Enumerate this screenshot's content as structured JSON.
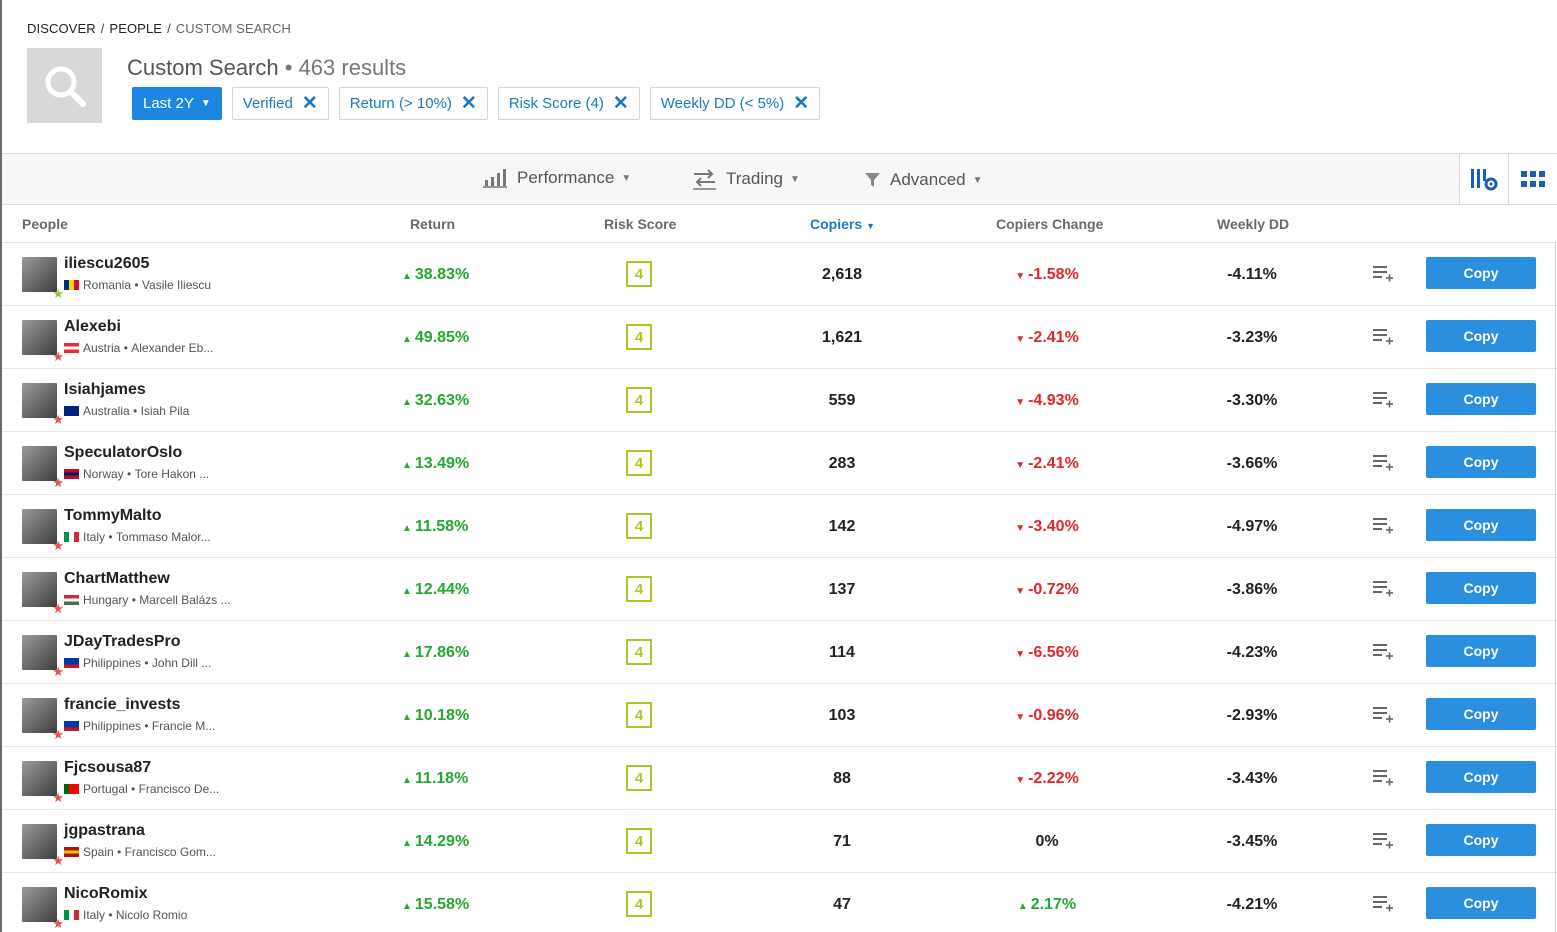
{
  "breadcrumb": [
    "DISCOVER",
    "PEOPLE",
    "CUSTOM SEARCH"
  ],
  "title": "Custom Search",
  "results": "• 463 results",
  "filters": [
    {
      "label": "Last 2Y",
      "primary": true
    },
    {
      "label": "Verified"
    },
    {
      "label": "Return (> 10%)"
    },
    {
      "label": "Risk Score (4)"
    },
    {
      "label": "Weekly DD (< 5%)"
    }
  ],
  "toolbar": {
    "performance": "Performance",
    "trading": "Trading",
    "advanced": "Advanced"
  },
  "columns": {
    "people": "People",
    "return": "Return",
    "risk": "Risk Score",
    "copiers": "Copiers",
    "change": "Copiers Change",
    "weekly_dd": "Weekly DD"
  },
  "copy_label": "Copy",
  "rows": [
    {
      "username": "iliescu2605",
      "country": "Romania",
      "name": "Vasile Iliescu",
      "flag": [
        "#002b7f",
        "#fcd116",
        "#ce1126"
      ],
      "flag_dir": "v",
      "verified_green": true,
      "return": "38.83%",
      "risk": "4",
      "copiers": "2,618",
      "change": "-1.58%",
      "change_dir": "neg",
      "weekly_dd": "-4.11%"
    },
    {
      "username": "Alexebi",
      "country": "Austria",
      "name": "Alexander Eb...",
      "flag": [
        "#ed2939",
        "#ffffff",
        "#ed2939"
      ],
      "flag_dir": "h",
      "return": "49.85%",
      "risk": "4",
      "copiers": "1,621",
      "change": "-2.41%",
      "change_dir": "neg",
      "weekly_dd": "-3.23%"
    },
    {
      "username": "Isiahjames",
      "country": "Australia",
      "name": "Isiah Pila",
      "flag": [
        "#00247d",
        "#00247d",
        "#00247d"
      ],
      "flag_dir": "h",
      "return": "32.63%",
      "risk": "4",
      "copiers": "559",
      "change": "-4.93%",
      "change_dir": "neg",
      "weekly_dd": "-3.30%"
    },
    {
      "username": "SpeculatorOslo",
      "country": "Norway",
      "name": "Tore Hakon ...",
      "flag": [
        "#ba0c2f",
        "#00205b",
        "#ba0c2f"
      ],
      "flag_dir": "h",
      "return": "13.49%",
      "risk": "4",
      "copiers": "283",
      "change": "-2.41%",
      "change_dir": "neg",
      "weekly_dd": "-3.66%"
    },
    {
      "username": "TommyMalto",
      "country": "Italy",
      "name": "Tommaso Malor...",
      "flag": [
        "#009246",
        "#ffffff",
        "#ce2b37"
      ],
      "flag_dir": "v",
      "return": "11.58%",
      "risk": "4",
      "copiers": "142",
      "change": "-3.40%",
      "change_dir": "neg",
      "weekly_dd": "-4.97%"
    },
    {
      "username": "ChartMatthew",
      "country": "Hungary",
      "name": "Marcell Balázs ...",
      "flag": [
        "#cd2a3e",
        "#ffffff",
        "#436f4d"
      ],
      "flag_dir": "h",
      "return": "12.44%",
      "risk": "4",
      "copiers": "137",
      "change": "-0.72%",
      "change_dir": "neg",
      "weekly_dd": "-3.86%"
    },
    {
      "username": "JDayTradesPro",
      "country": "Philippines",
      "name": "John Dill ...",
      "flag": [
        "#0038a8",
        "#0038a8",
        "#ce1126"
      ],
      "flag_dir": "h",
      "return": "17.86%",
      "risk": "4",
      "copiers": "114",
      "change": "-6.56%",
      "change_dir": "neg",
      "weekly_dd": "-4.23%"
    },
    {
      "username": "francie_invests",
      "country": "Philippines",
      "name": "Francie M...",
      "flag": [
        "#0038a8",
        "#0038a8",
        "#ce1126"
      ],
      "flag_dir": "h",
      "return": "10.18%",
      "risk": "4",
      "copiers": "103",
      "change": "-0.96%",
      "change_dir": "neg",
      "weekly_dd": "-2.93%"
    },
    {
      "username": "Fjcsousa87",
      "country": "Portugal",
      "name": "Francisco De...",
      "flag": [
        "#006600",
        "#ff0000",
        "#ff0000"
      ],
      "flag_dir": "v",
      "return": "11.18%",
      "risk": "4",
      "copiers": "88",
      "change": "-2.22%",
      "change_dir": "neg",
      "weekly_dd": "-3.43%"
    },
    {
      "username": "jgpastrana",
      "country": "Spain",
      "name": "Francisco Gom...",
      "flag": [
        "#aa151b",
        "#f1bf00",
        "#aa151b"
      ],
      "flag_dir": "h",
      "return": "14.29%",
      "risk": "4",
      "copiers": "71",
      "change": "0%",
      "change_dir": "zero",
      "weekly_dd": "-3.45%"
    },
    {
      "username": "NicoRomix",
      "country": "Italy",
      "name": "Nicolo Romio",
      "flag": [
        "#009246",
        "#ffffff",
        "#ce2b37"
      ],
      "flag_dir": "v",
      "return": "15.58%",
      "risk": "4",
      "copiers": "47",
      "change": "2.17%",
      "change_dir": "pos",
      "weekly_dd": "-4.21%"
    }
  ]
}
